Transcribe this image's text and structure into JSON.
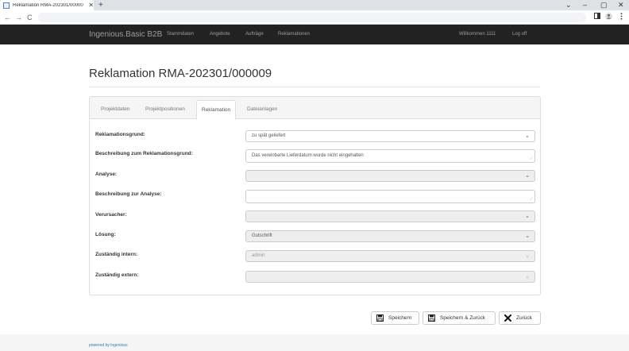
{
  "browser": {
    "tab_title": "Reklamation RMA-202301/00000",
    "tab_close": "✕",
    "new_tab": "+",
    "back": "←",
    "forward": "→",
    "reload": "C",
    "window_controls": {
      "dropdown": "⌄",
      "minimize": "–",
      "maximize": "▢",
      "close": "✕"
    }
  },
  "navbar": {
    "brand": "Ingenious.Basic B2B",
    "items": [
      {
        "label": "Stammdaten"
      },
      {
        "label": "Angebote"
      },
      {
        "label": "Aufträge"
      },
      {
        "label": "Reklamationen"
      }
    ],
    "welcome": "Willkommen 1111",
    "logout": "Log off"
  },
  "page": {
    "title": "Reklamation RMA-202301/000009"
  },
  "tabs": [
    {
      "label": "Projektdaten"
    },
    {
      "label": "Projektpositionen"
    },
    {
      "label": "Reklamation",
      "active": true
    },
    {
      "label": "Dateianlagen"
    }
  ],
  "form": {
    "fields": [
      {
        "label": "Reklamationsgrund:",
        "value": "zu spät geliefert",
        "type": "select"
      },
      {
        "label": "Beschreibung zum Reklamationsgrund:",
        "value": "Das vereinbarte Lieferdatum wurde nicht eingehalten",
        "type": "textarea"
      },
      {
        "label": "Analyse:",
        "value": "",
        "type": "select"
      },
      {
        "label": "Beschreibung zur Analyse:",
        "value": "",
        "type": "textarea"
      },
      {
        "label": "Verursacher:",
        "value": "",
        "type": "select"
      },
      {
        "label": "Lösung:",
        "value": "Gutschrift",
        "type": "select"
      },
      {
        "label": "Zuständig intern:",
        "value": "admin",
        "type": "select-disabled"
      },
      {
        "label": "Zuständig extern:",
        "value": "",
        "type": "select-disabled"
      }
    ]
  },
  "actions": {
    "save": "Speichern",
    "save_back": "Speichern & Zurück",
    "back": "Zurück"
  },
  "footer": {
    "link": "powered by ingenious"
  },
  "icons": {
    "save": "floppy-disk-icon",
    "back": "x-icon",
    "caret": "⌄"
  }
}
